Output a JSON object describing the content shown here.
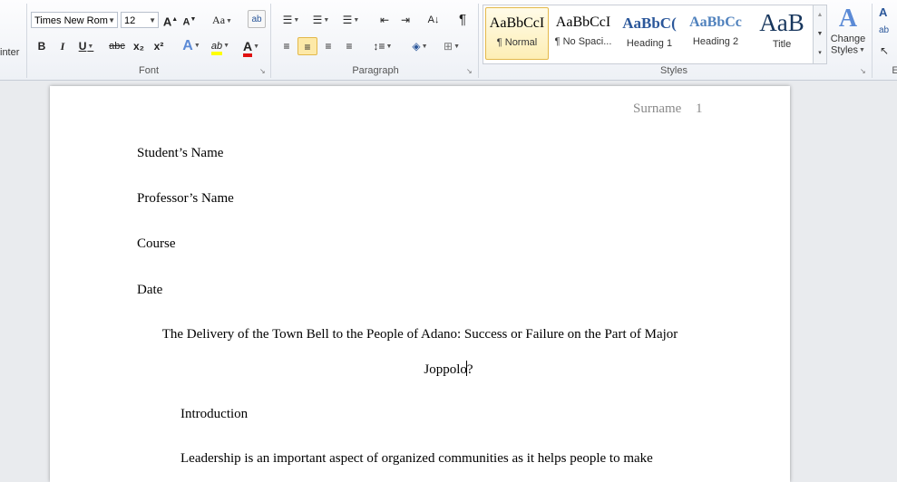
{
  "ribbon": {
    "clipboard_fragment": "inter",
    "font": {
      "label": "Font",
      "family": "Times New Rom",
      "size": "12",
      "grow_label": "A",
      "shrink_label": "A",
      "change_case_label": "Aa",
      "bold": "B",
      "italic": "I",
      "underline": "U",
      "strike": "abc",
      "subscript": "x₂",
      "superscript": "x²",
      "text_effects": "A",
      "highlight": "ab",
      "font_color": "A"
    },
    "paragraph": {
      "label": "Paragraph",
      "pilcrow": "¶"
    },
    "styles": {
      "label": "Styles",
      "items": [
        {
          "sample": "AaBbCcI",
          "name": "¶ Normal"
        },
        {
          "sample": "AaBbCcI",
          "name": "¶ No Spaci..."
        },
        {
          "sample": "AaBbC(",
          "name": "Heading 1"
        },
        {
          "sample": "AaBbCc",
          "name": "Heading 2"
        },
        {
          "sample": "AaB",
          "name": "Title"
        }
      ],
      "change_styles_line1": "Change",
      "change_styles_line2": "Styles",
      "change_styles_glyph": "A"
    },
    "editing_fragment": "E",
    "colors": {
      "accent": "#2b579a",
      "highlight": "#ffff00",
      "font_color": "#e01010",
      "selected_bg": "#fde9a8"
    }
  },
  "document": {
    "header": {
      "surname": "Surname",
      "page_number": "1"
    },
    "lines": {
      "student": "Student’s Name",
      "professor": "Professor’s Name",
      "course": "Course",
      "date": "Date",
      "title_line1": "The Delivery of the Town Bell to the People of Adano: Success or Failure on the Part of Major",
      "title_line2": "Joppolo?",
      "introduction": "Introduction",
      "body_line1": "Leadership is an important aspect of organized communities as it helps people to make"
    }
  }
}
